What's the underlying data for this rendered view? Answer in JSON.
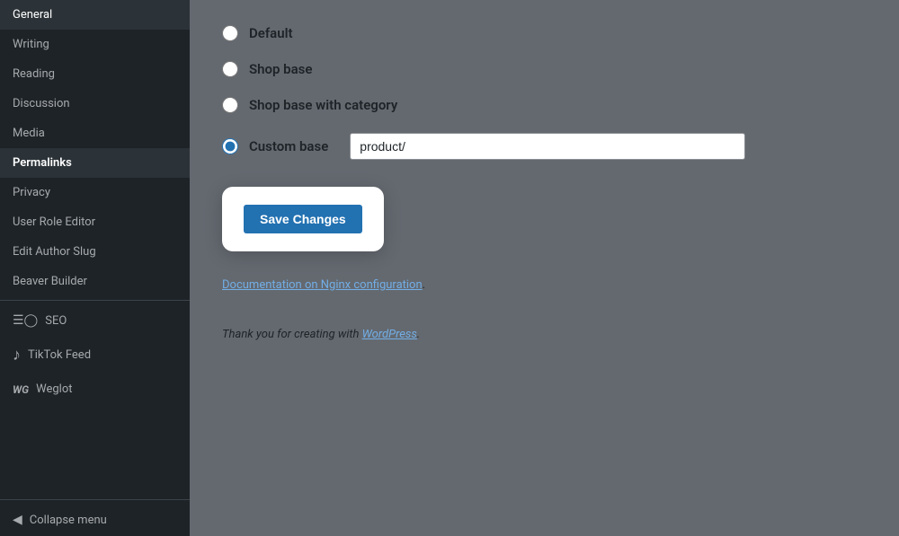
{
  "sidebar": {
    "items": [
      {
        "id": "general",
        "label": "General",
        "active": false,
        "bold": false
      },
      {
        "id": "writing",
        "label": "Writing",
        "active": false,
        "bold": false
      },
      {
        "id": "reading",
        "label": "Reading",
        "active": false,
        "bold": false
      },
      {
        "id": "discussion",
        "label": "Discussion",
        "active": false,
        "bold": false
      },
      {
        "id": "media",
        "label": "Media",
        "active": false,
        "bold": false
      },
      {
        "id": "permalinks",
        "label": "Permalinks",
        "active": true,
        "bold": true
      },
      {
        "id": "privacy",
        "label": "Privacy",
        "active": false,
        "bold": false
      },
      {
        "id": "user-role-editor",
        "label": "User Role Editor",
        "active": false,
        "bold": false
      },
      {
        "id": "edit-author-slug",
        "label": "Edit Author Slug",
        "active": false,
        "bold": false
      },
      {
        "id": "beaver-builder",
        "label": "Beaver Builder",
        "active": false,
        "bold": false
      }
    ],
    "seo_label": "SEO",
    "tiktok_label": "TikTok Feed",
    "weglot_label": "Weglot",
    "collapse_label": "Collapse menu"
  },
  "main": {
    "radio_options": [
      {
        "id": "default",
        "label": "Default",
        "checked": false
      },
      {
        "id": "shop-base",
        "label": "Shop base",
        "checked": false
      },
      {
        "id": "shop-base-category",
        "label": "Shop base with category",
        "checked": false
      },
      {
        "id": "custom-base",
        "label": "Custom base",
        "checked": true
      }
    ],
    "custom_base_value": "product/",
    "save_button_label": "Save Changes",
    "doc_link_text": "Documentation on Nginx configuration",
    "doc_suffix": ".",
    "footer_text": "Thank you for creating with ",
    "footer_link": "WordPress",
    "footer_suffix": "."
  }
}
